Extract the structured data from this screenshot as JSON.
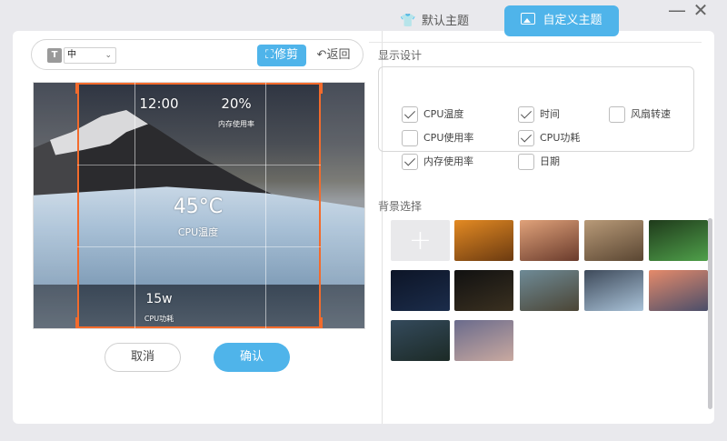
{
  "window": {
    "minimize_glyph": "—",
    "close_glyph": "✕"
  },
  "editor": {
    "font_icon_text": "T",
    "font_size_value": "中",
    "crop_label": "修剪",
    "undo_label": "返回",
    "cancel_label": "取消",
    "confirm_label": "确认",
    "overlay": {
      "time": "12:00",
      "memory_value": "20%",
      "memory_label": "内存使用率",
      "cpu_temp_value": "45°C",
      "cpu_temp_label": "CPU温度",
      "cpu_power_value": "15w",
      "cpu_power_label": "CPU功耗"
    }
  },
  "tabs": {
    "default_theme": "默认主题",
    "custom_theme": "自定义主题",
    "active": "custom_theme"
  },
  "display_settings": {
    "title": "显示设计",
    "options": [
      {
        "label": "CPU温度",
        "checked": true
      },
      {
        "label": "时间",
        "checked": true
      },
      {
        "label": "风扇转速",
        "checked": false
      },
      {
        "label": "CPU使用率",
        "checked": false
      },
      {
        "label": "CPU功耗",
        "checked": true
      },
      {
        "label": "内存使用率",
        "checked": true
      },
      {
        "label": "日期",
        "checked": false
      }
    ]
  },
  "background_selection": {
    "title": "背景选择",
    "add_glyph": "+",
    "thumbnails": [
      {
        "name": "orange-leaves",
        "colors": [
          "#e38a23",
          "#6b3a10"
        ]
      },
      {
        "name": "red-mountain-sunset",
        "colors": [
          "#e0a27a",
          "#6a3b2c"
        ]
      },
      {
        "name": "desert-hills",
        "colors": [
          "#b89a78",
          "#5a4632"
        ]
      },
      {
        "name": "green-leaf-dark",
        "colors": [
          "#1f3a1b",
          "#4fa04a"
        ]
      },
      {
        "name": "night-road",
        "colors": [
          "#0d1527",
          "#1b2c4a"
        ]
      },
      {
        "name": "dark-moon",
        "colors": [
          "#111111",
          "#3a3020"
        ]
      },
      {
        "name": "valley-mountains",
        "colors": [
          "#6e8a96",
          "#4b4535"
        ]
      },
      {
        "name": "glacier-penguins",
        "colors": [
          "#3e4a5a",
          "#a9c2d8"
        ]
      },
      {
        "name": "pink-sunset-peaks",
        "colors": [
          "#e58a6a",
          "#4a4e6a"
        ]
      },
      {
        "name": "lake-forest",
        "colors": [
          "#344a5c",
          "#1c2a26"
        ]
      },
      {
        "name": "purple-mountain-range",
        "colors": [
          "#6a6b8c",
          "#c9a9a0"
        ]
      }
    ]
  }
}
